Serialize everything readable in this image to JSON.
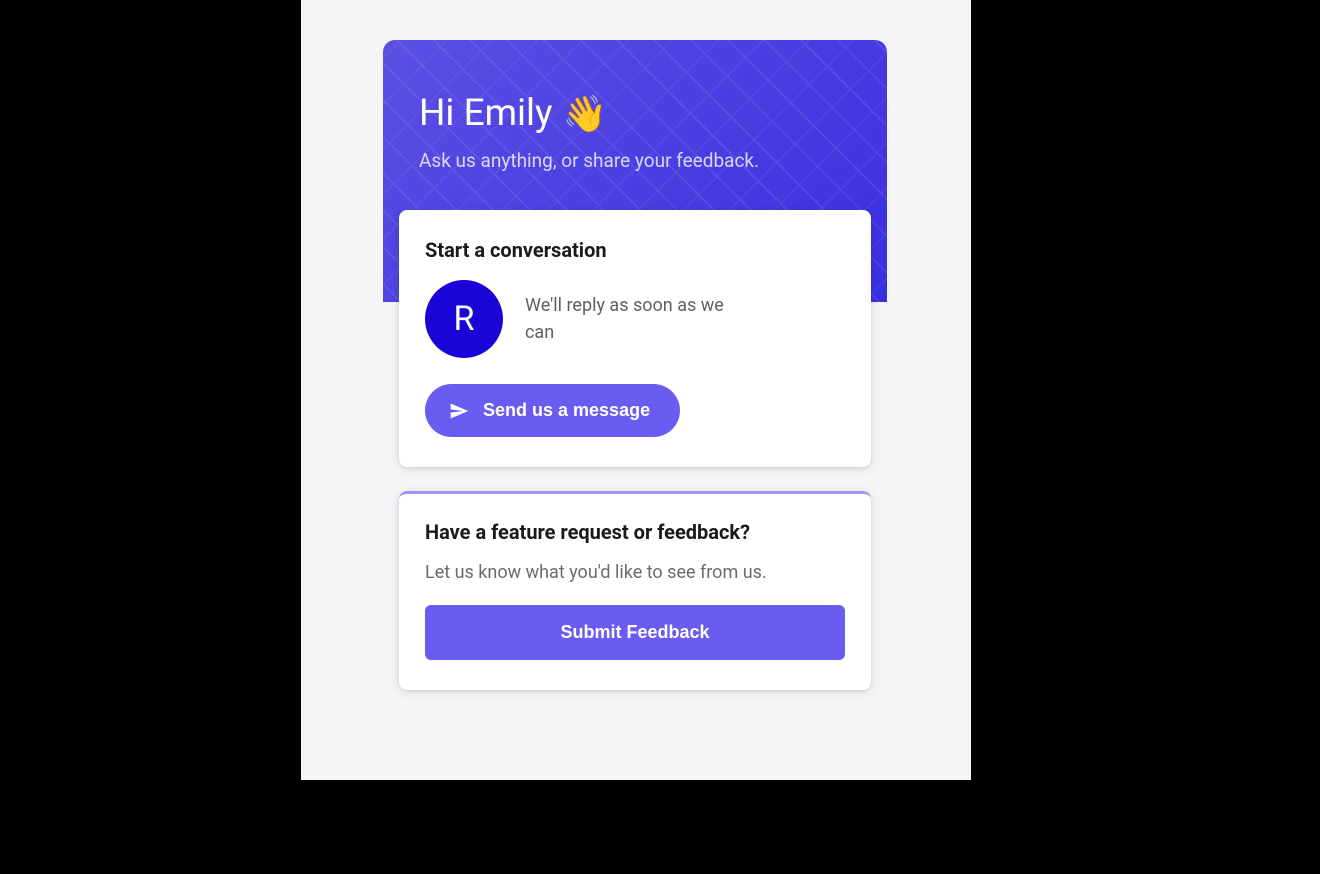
{
  "header": {
    "greeting": "Hi Emily",
    "wave_emoji": "👋",
    "subtitle": "Ask us anything, or share your feedback."
  },
  "conversation_card": {
    "title": "Start a conversation",
    "avatar_letter": "R",
    "reply_text": "We'll reply as soon as we can",
    "button_label": "Send us a message"
  },
  "feedback_card": {
    "title": "Have a feature request or feedback?",
    "subtitle": "Let us know what you'd like to see from us.",
    "button_label": "Submit Feedback"
  },
  "colors": {
    "accent": "#6a5cf1",
    "avatar_bg": "#1b04d6"
  }
}
